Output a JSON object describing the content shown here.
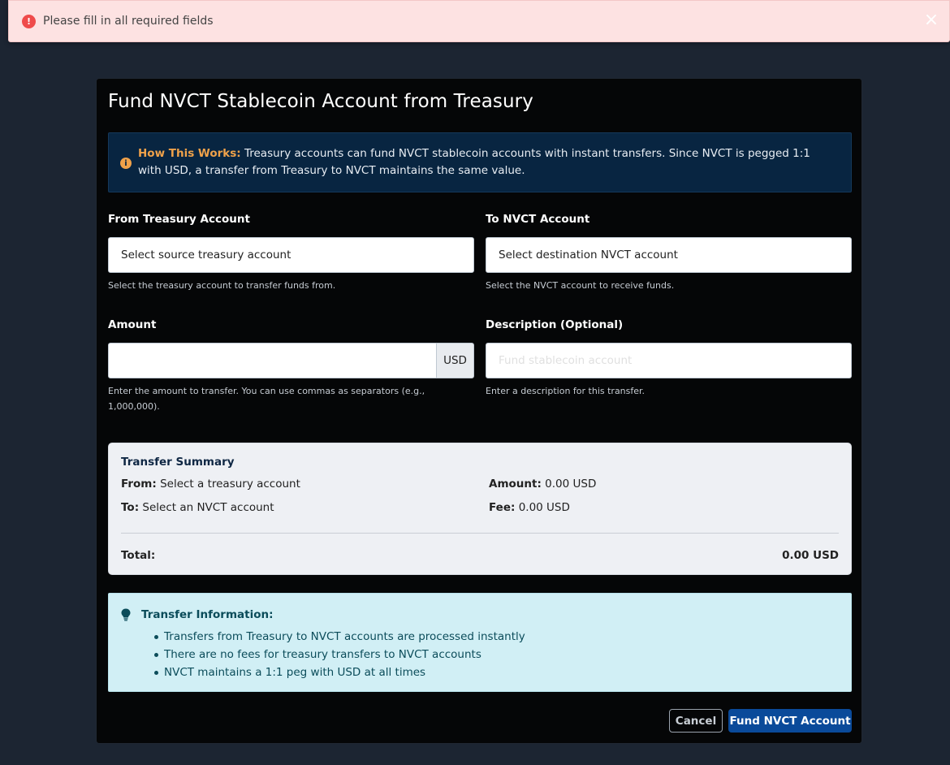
{
  "toast": {
    "icon": "alert-circle-icon",
    "message": "Please fill in all required fields",
    "close_icon": "close-icon"
  },
  "modal": {
    "title": "Fund NVCT Stablecoin Account from Treasury",
    "how_it_works": {
      "label": "How This Works:",
      "text": "Treasury accounts can fund NVCT stablecoin accounts with instant transfers. Since NVCT is pegged 1:1 with USD, a transfer from Treasury to NVCT maintains the same value."
    },
    "from": {
      "label": "From Treasury Account",
      "value": "Select source treasury account",
      "helper": "Select the treasury account to transfer funds from."
    },
    "to": {
      "label": "To NVCT Account",
      "value": "Select destination NVCT account",
      "helper": "Select the NVCT account to receive funds."
    },
    "amount": {
      "label": "Amount",
      "value": "",
      "addon": "USD",
      "helper": "Enter the amount to transfer. You can use commas as separators (e.g., 1,000,000)."
    },
    "description": {
      "label": "Description (Optional)",
      "placeholder": "Fund stablecoin account",
      "helper": "Enter a description for this transfer."
    },
    "summary": {
      "title": "Transfer Summary",
      "from_label": "From:",
      "from_value": "Select a treasury account",
      "to_label": "To:",
      "to_value": "Select an NVCT account",
      "amount_label": "Amount:",
      "amount_value": "0.00 USD",
      "fee_label": "Fee:",
      "fee_value": "0.00 USD",
      "total_label": "Total:",
      "total_value": "0.00 USD"
    },
    "transfer_info": {
      "title": "Transfer Information:",
      "items": [
        "Transfers from Treasury to NVCT accounts are processed instantly",
        "There are no fees for treasury transfers to NVCT accounts",
        "NVCT maintains a 1:1 peg with USD at all times"
      ]
    },
    "buttons": {
      "cancel": "Cancel",
      "submit": "Fund NVCT Account"
    }
  }
}
